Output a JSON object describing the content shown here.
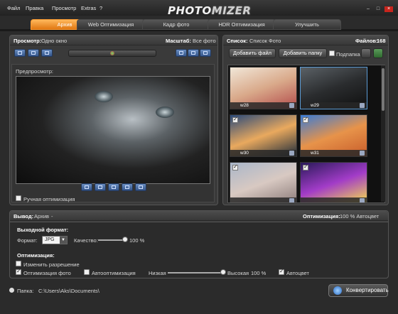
{
  "menu": [
    "Файл",
    "Правка",
    "Просмотр",
    "Extras",
    "?"
  ],
  "logo": {
    "part1": "PHOTO",
    "part2": "MIZER"
  },
  "window_buttons": {
    "minimize": "–",
    "maximize": "□",
    "close": "×"
  },
  "tabs": [
    {
      "label": "Архив",
      "active": true
    },
    {
      "label": "Web Оптимизация",
      "active": false
    },
    {
      "label": "Кадр фото",
      "active": false
    },
    {
      "label": "HDR Оптимизация",
      "active": false
    },
    {
      "label": "Улучшить",
      "active": false
    }
  ],
  "preview_panel": {
    "view_label": "Просмотр:",
    "view_value": "Одно окно",
    "scale_label": "Масштаб:",
    "scale_value": "Все фото",
    "preview_title": "Предпросмотр:",
    "manual_opt_label": "Ручная оптимизация"
  },
  "list_panel": {
    "list_label": "Список:",
    "list_value": "Список Фото",
    "files_label": "Файлов:",
    "files_count": "168",
    "add_file": "Добавить файл",
    "add_folder": "Добавить папку",
    "subfolder": "Подпапка",
    "thumbnails": [
      {
        "caption": "w28",
        "checked": false,
        "colors": [
          "#f1e7d8",
          "#d9a98a",
          "#b24a4a"
        ]
      },
      {
        "caption": "w29",
        "checked": false,
        "colors": [
          "#5b6166",
          "#2a2c2e",
          "#0f0f0f"
        ]
      },
      {
        "caption": "w30",
        "checked": true,
        "colors": [
          "#2a4a7a",
          "#e9a95e",
          "#1c2a3a"
        ]
      },
      {
        "caption": "w31",
        "checked": true,
        "colors": [
          "#3a7bd5",
          "#e7934a",
          "#c75c2a"
        ]
      },
      {
        "caption": "",
        "checked": true,
        "colors": [
          "#a9b6c9",
          "#d8c9c2",
          "#8a7a78"
        ]
      },
      {
        "caption": "",
        "checked": true,
        "colors": [
          "#2a1a5a",
          "#a23cc8",
          "#f7e04a"
        ]
      }
    ]
  },
  "output": {
    "label": "Вывод:",
    "value": "Архив",
    "dash": "-",
    "optimization_label": "Оптимизация:",
    "optimization_value": "100 % Автоцвет",
    "format_title": "Выходной формат:",
    "format_label": "Формат:",
    "format_value": "JPG",
    "quality_label": "Качество:",
    "quality_value": "100 %",
    "quality_fraction": 1.0,
    "optimization_title": "Оптимизация:",
    "resize_label": "Изменить разрешение",
    "photo_opt_label": "Оптимизация фото",
    "auto_opt_label": "Автооптимизация",
    "low_label": "Низкая",
    "high_label": "Высокая",
    "level_value": "100 %",
    "level_fraction": 1.0,
    "autocolor_label": "Автоцвет"
  },
  "folder": {
    "label": "Папка:",
    "path": "C:\\Users\\Aks\\Documents\\"
  },
  "convert_label": "Конвертировать"
}
